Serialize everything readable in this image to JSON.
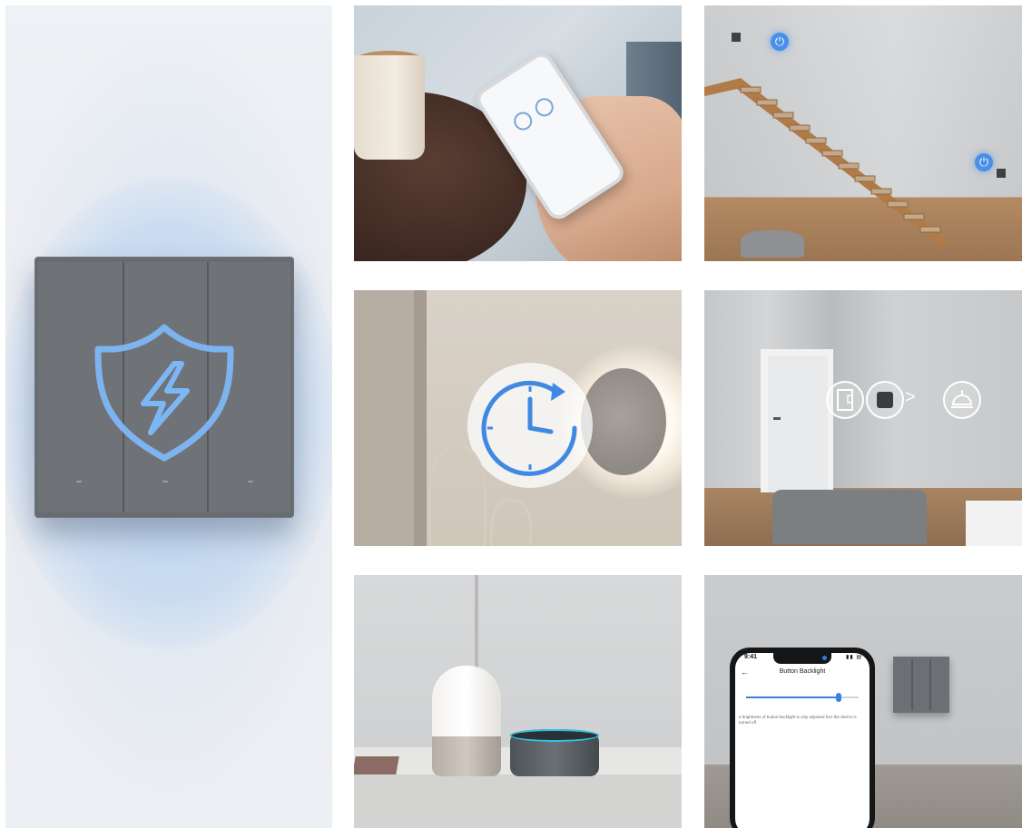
{
  "hero": {
    "icon": "shield-lightning-icon",
    "accent": "#5ea4f0",
    "switch_color": "#6f7378"
  },
  "photos": [
    {
      "id": "phone-control",
      "icon": "smartphone-app-icon"
    },
    {
      "id": "staircase-switches",
      "icon": "power-icon"
    },
    {
      "id": "timer-wall-light",
      "icon": "clock-timer-icon"
    },
    {
      "id": "scene-automation",
      "icons": [
        "door-sensor-icon",
        "switch-icon",
        "ceiling-light-icon"
      ],
      "arrow": ">"
    },
    {
      "id": "voice-assistant-speakers",
      "icon": "smart-speaker-icon"
    },
    {
      "id": "button-backlight-app",
      "icon": "slider-icon"
    }
  ],
  "app_screen": {
    "time": "9:41",
    "status_icons": "▮▮ ▤",
    "back": "←",
    "title": "Button Backlight",
    "slider_value_fraction": 0.82,
    "description": "e brightness of button backlight is only adjusted hen the device is turned off."
  },
  "colors": {
    "power_icon_blue": "#4a8fe7",
    "clock_blue": "#3f88e3",
    "echo_ring": "#31c0e8"
  }
}
